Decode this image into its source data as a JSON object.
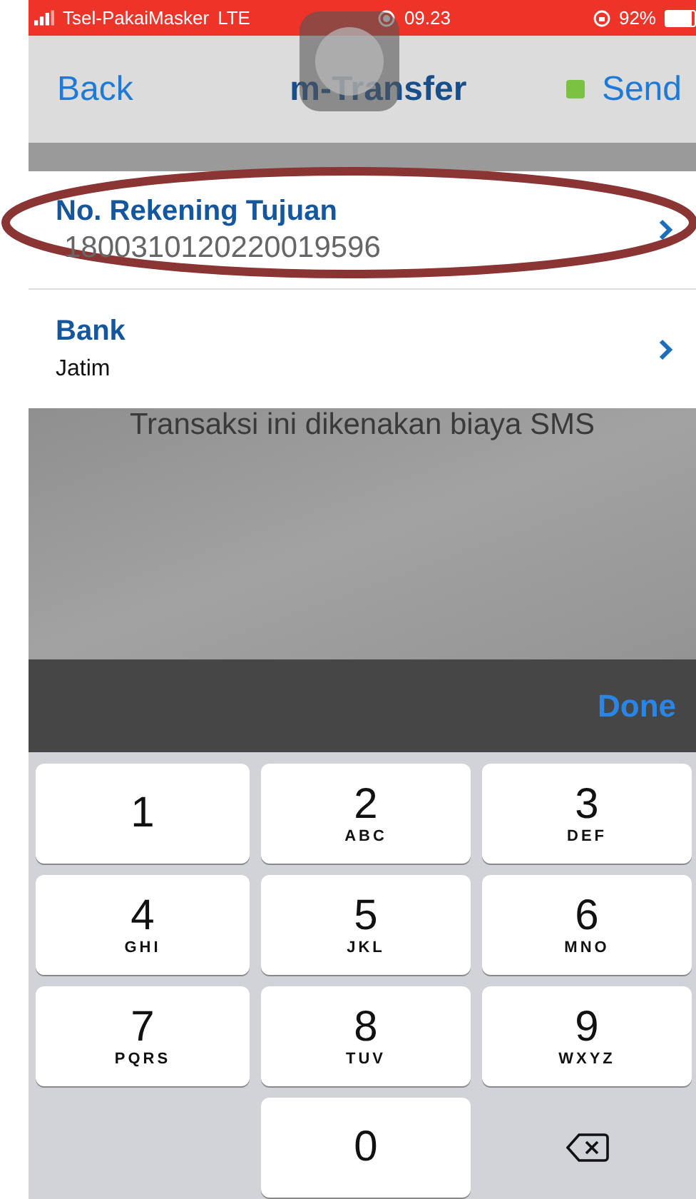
{
  "status_bar": {
    "carrier": "Tsel-PakaiMasker",
    "network": "LTE",
    "time": "09.23",
    "battery": "92%"
  },
  "nav": {
    "back": "Back",
    "title": "m-Transfer",
    "send": "Send"
  },
  "fields": [
    {
      "label": "No. Rekening Tujuan",
      "value": "1800310120220019596",
      "focused": true
    },
    {
      "label": "Bank",
      "value": "Jatim",
      "focused": false
    }
  ],
  "notice": "Transaksi ini dikenakan biaya SMS",
  "toolbar": {
    "done": "Done"
  },
  "keypad": [
    {
      "kind": "digit",
      "digit": "1"
    },
    {
      "kind": "digit",
      "digit": "2",
      "letters": "ABC"
    },
    {
      "kind": "digit",
      "digit": "3",
      "letters": "DEF"
    },
    {
      "kind": "digit",
      "digit": "4",
      "letters": "GHI"
    },
    {
      "kind": "digit",
      "digit": "5",
      "letters": "JKL"
    },
    {
      "kind": "digit",
      "digit": "6",
      "letters": "MNO"
    },
    {
      "kind": "digit",
      "digit": "7",
      "letters": "PQRS"
    },
    {
      "kind": "digit",
      "digit": "8",
      "letters": "TUV"
    },
    {
      "kind": "digit",
      "digit": "9",
      "letters": "WXYZ"
    },
    {
      "kind": "blank"
    },
    {
      "kind": "digit",
      "digit": "0"
    },
    {
      "kind": "delete"
    }
  ]
}
